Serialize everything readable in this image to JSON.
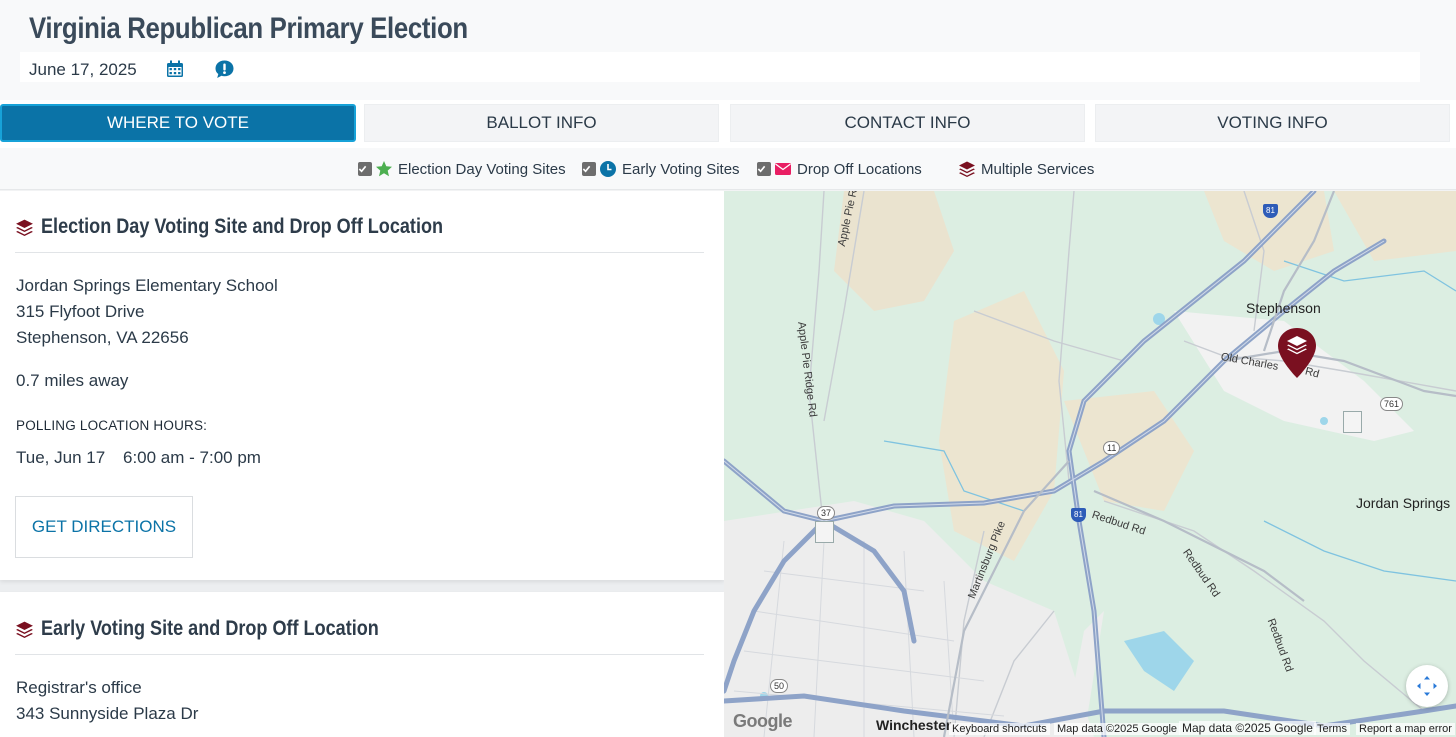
{
  "header": {
    "title": "Virginia Republican Primary Election",
    "date": "June 17, 2025",
    "calendar_icon": "calendar-icon",
    "alert_icon": "alert-bubble-icon"
  },
  "tabs": [
    {
      "label": "WHERE TO VOTE",
      "active": true
    },
    {
      "label": "BALLOT INFO",
      "active": false
    },
    {
      "label": "CONTACT INFO",
      "active": false
    },
    {
      "label": "VOTING INFO",
      "active": false
    }
  ],
  "legend": [
    {
      "label": "Election Day Voting Sites",
      "checked": true,
      "icon": "star-icon",
      "color": "#4caf50"
    },
    {
      "label": "Early Voting Sites",
      "checked": true,
      "icon": "clock-icon",
      "color": "#0b73a7"
    },
    {
      "label": "Drop Off Locations",
      "checked": true,
      "icon": "envelope-icon",
      "color": "#e91e63"
    },
    {
      "label": "Multiple Services",
      "icon": "layers-icon",
      "color": "#7a1020"
    }
  ],
  "cards": [
    {
      "title": "Election Day Voting Site and Drop Off Location",
      "name": "Jordan Springs Elementary School",
      "address1": "315 Flyfoot Drive",
      "address2": "Stephenson, VA 22656",
      "distance": "0.7 miles away",
      "hours_label": "POLLING LOCATION HOURS:",
      "hours_day": "Tue, Jun 17",
      "hours_time": "6:00 am - 7:00 pm",
      "button": "GET DIRECTIONS"
    },
    {
      "title": "Early Voting Site and Drop Off Location",
      "name": "Registrar's office",
      "address1": "343 Sunnyside Plaza Dr"
    }
  ],
  "map": {
    "towns": [
      "Stephenson",
      "Jordan Springs",
      "Winchester"
    ],
    "roads": [
      "Apple Pie Ridge Rd",
      "Apple Pie R",
      "Old Charles",
      "n Rd",
      "Martinsburg Pike",
      "Redbud Rd"
    ],
    "shields": [
      "81",
      "11",
      "37",
      "50",
      "761"
    ],
    "footer": {
      "keyboard": "Keyboard shortcuts",
      "map_data": "Map data ©2025 Google",
      "map_data2": "Map data ©2025 Google",
      "terms": "Terms",
      "report": "Report a map error"
    },
    "logo": "Google",
    "colors": {
      "pin": "#7a1020",
      "highway": "#8ea3c8",
      "water": "#9ed6ea"
    }
  }
}
